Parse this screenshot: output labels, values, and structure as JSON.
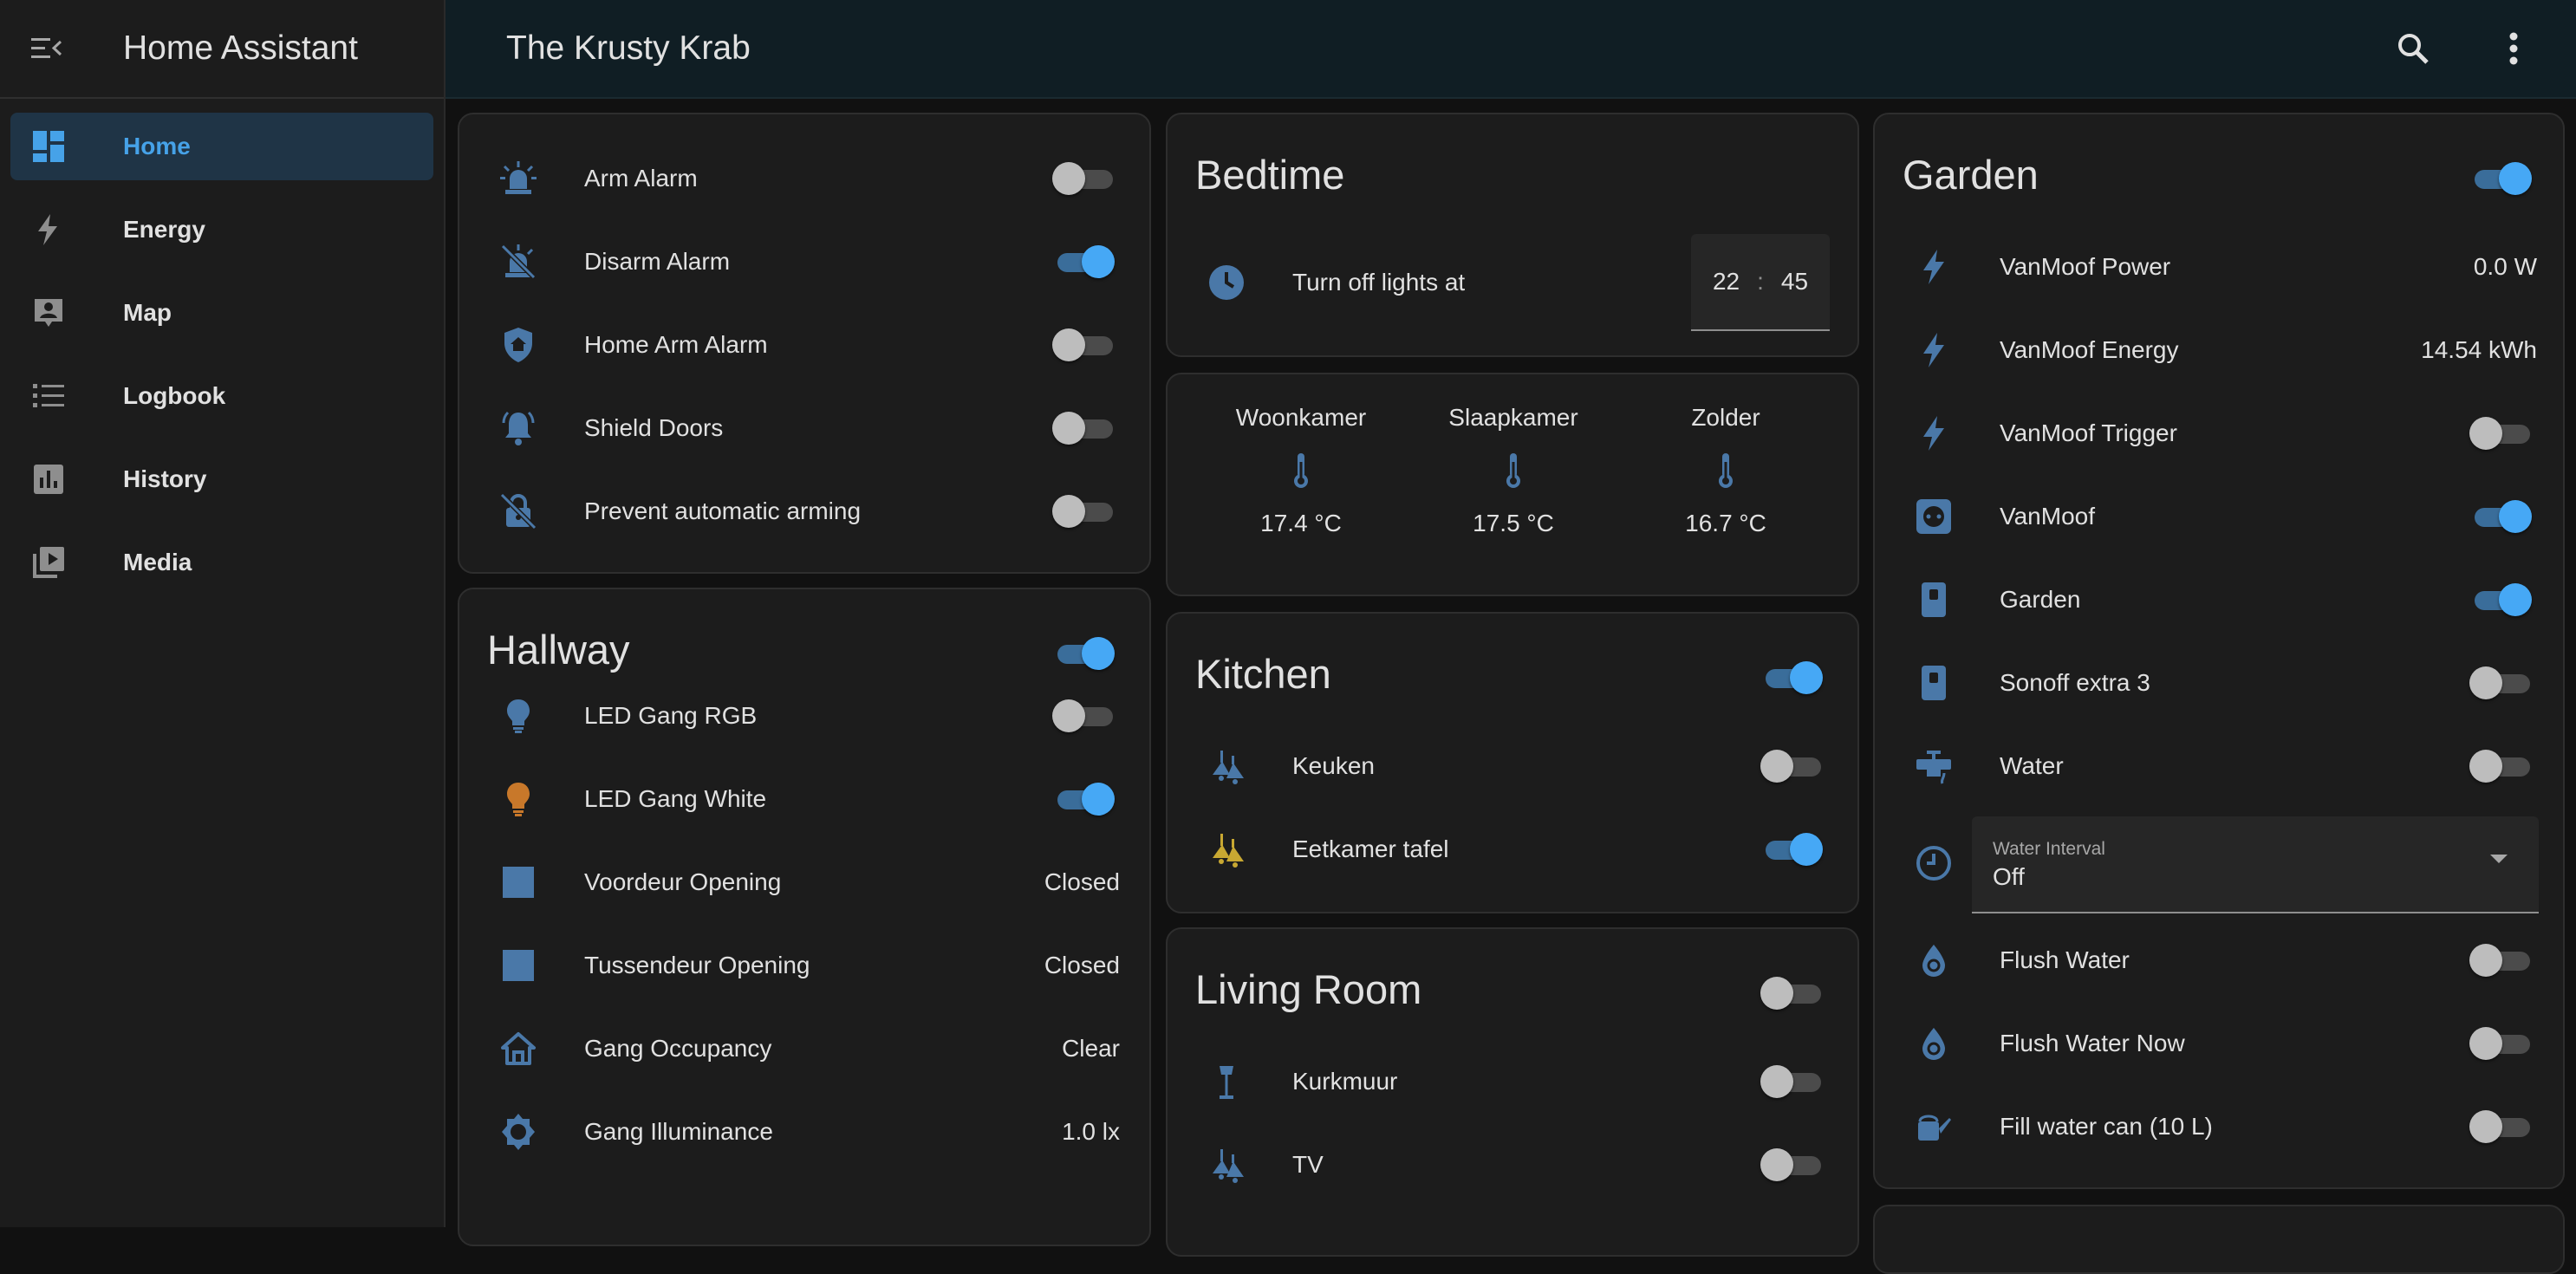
{
  "sidebar": {
    "title": "Home Assistant",
    "items": [
      {
        "label": "Home"
      },
      {
        "label": "Energy"
      },
      {
        "label": "Map"
      },
      {
        "label": "Logbook"
      },
      {
        "label": "History"
      },
      {
        "label": "Media"
      }
    ]
  },
  "topbar": {
    "title": "The Krusty Krab"
  },
  "alarm_card": {
    "rows": [
      {
        "name": "Arm Alarm",
        "on": false
      },
      {
        "name": "Disarm Alarm",
        "on": true
      },
      {
        "name": "Home Arm Alarm",
        "on": false
      },
      {
        "name": "Shield Doors",
        "on": false
      },
      {
        "name": "Prevent automatic arming",
        "on": false
      }
    ]
  },
  "hallway": {
    "title": "Hallway",
    "on": true,
    "rows": [
      {
        "name": "LED Gang RGB",
        "on": false
      },
      {
        "name": "LED Gang White",
        "on": true
      },
      {
        "name": "Voordeur Opening",
        "state": "Closed"
      },
      {
        "name": "Tussendeur Opening",
        "state": "Closed"
      },
      {
        "name": "Gang Occupancy",
        "state": "Clear"
      },
      {
        "name": "Gang Illuminance",
        "state": "1.0 lx"
      }
    ]
  },
  "bedtime": {
    "title": "Bedtime",
    "row_name": "Turn off lights at",
    "hour": "22",
    "separator": ":",
    "minute": "45"
  },
  "temps": [
    {
      "name": "Woonkamer",
      "value": "17.4 °C"
    },
    {
      "name": "Slaapkamer",
      "value": "17.5 °C"
    },
    {
      "name": "Zolder",
      "value": "16.7 °C"
    }
  ],
  "kitchen": {
    "title": "Kitchen",
    "on": true,
    "rows": [
      {
        "name": "Keuken",
        "on": false
      },
      {
        "name": "Eetkamer tafel",
        "on": true
      }
    ]
  },
  "living_room": {
    "title": "Living Room",
    "on": false,
    "rows": [
      {
        "name": "Kurkmuur",
        "on": false
      },
      {
        "name": "TV",
        "on": false
      }
    ]
  },
  "garden": {
    "title": "Garden",
    "on": true,
    "rows": [
      {
        "name": "VanMoof Power",
        "state": "0.0 W"
      },
      {
        "name": "VanMoof Energy",
        "state": "14.54 kWh"
      },
      {
        "name": "VanMoof Trigger",
        "on": false
      },
      {
        "name": "VanMoof",
        "on": true
      },
      {
        "name": "Garden",
        "on": true
      },
      {
        "name": "Sonoff extra 3",
        "on": false
      },
      {
        "name": "Water",
        "on": false
      }
    ],
    "water_interval": {
      "label": "Water Interval",
      "value": "Off"
    },
    "rows2": [
      {
        "name": "Flush Water",
        "on": false
      },
      {
        "name": "Flush Water Now",
        "on": false
      },
      {
        "name": "Fill water can (10 L)",
        "on": false
      }
    ]
  },
  "colors": {
    "accent": "#46a2e8",
    "icon": "#4a78a8",
    "toggle_on": "#46a8f5",
    "bulb_on": "#c8782a",
    "lamp_on": "#c8a832"
  }
}
